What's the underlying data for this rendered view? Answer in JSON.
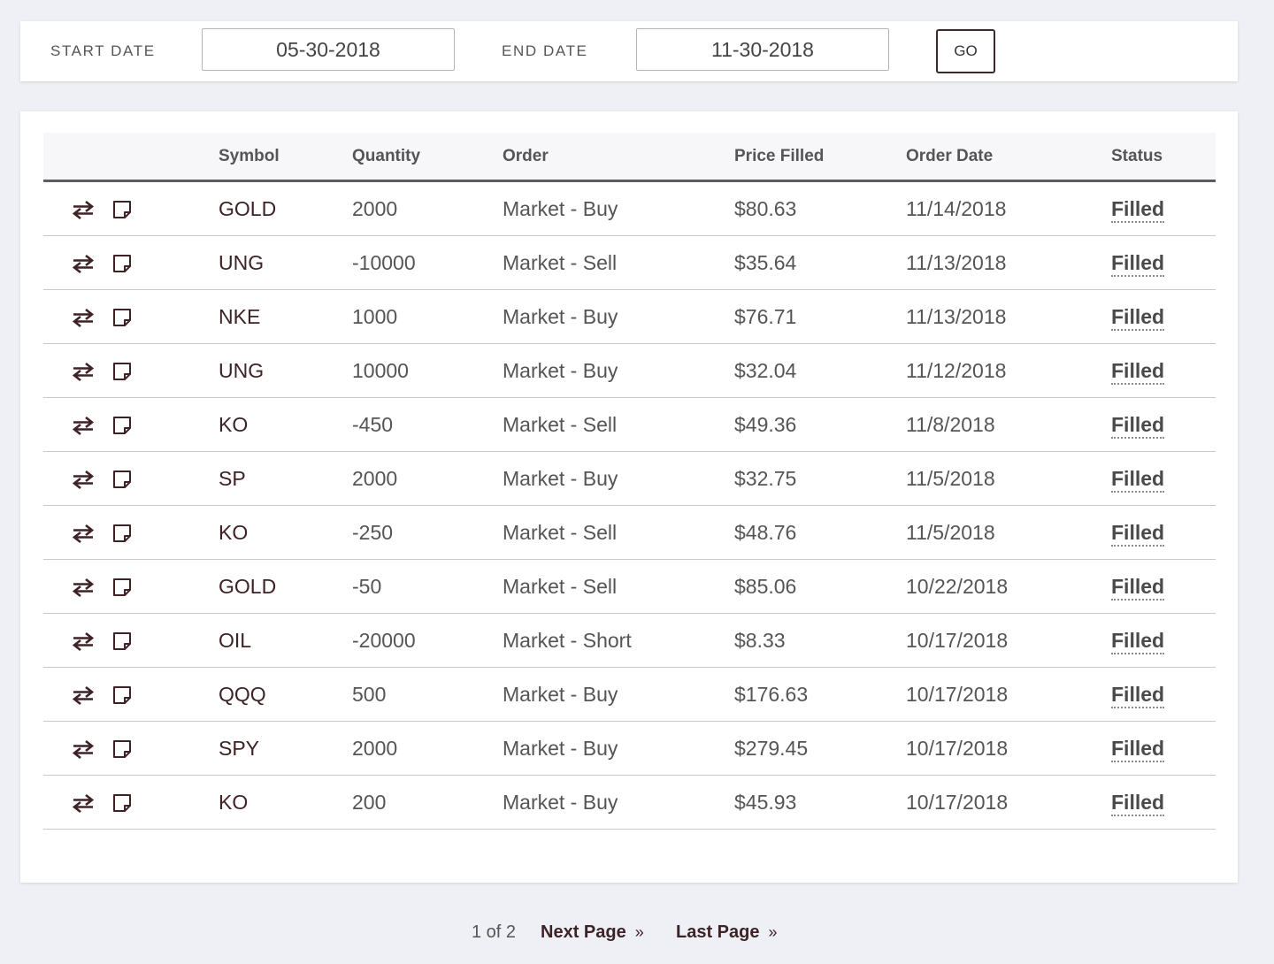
{
  "filter": {
    "start_label": "START DATE",
    "start_value": "05-30-2018",
    "end_label": "END DATE",
    "end_value": "11-30-2018",
    "go_label": "GO"
  },
  "table": {
    "headers": {
      "symbol": "Symbol",
      "quantity": "Quantity",
      "order": "Order",
      "price_filled": "Price Filled",
      "order_date": "Order Date",
      "status": "Status"
    },
    "row_icons": [
      "swap-arrows-icon",
      "note-icon"
    ],
    "rows": [
      {
        "symbol": "GOLD",
        "quantity": "2000",
        "order": "Market - Buy",
        "price": "$80.63",
        "date": "11/14/2018",
        "status": "Filled"
      },
      {
        "symbol": "UNG",
        "quantity": "-10000",
        "order": "Market - Sell",
        "price": "$35.64",
        "date": "11/13/2018",
        "status": "Filled"
      },
      {
        "symbol": "NKE",
        "quantity": "1000",
        "order": "Market - Buy",
        "price": "$76.71",
        "date": "11/13/2018",
        "status": "Filled"
      },
      {
        "symbol": "UNG",
        "quantity": "10000",
        "order": "Market - Buy",
        "price": "$32.04",
        "date": "11/12/2018",
        "status": "Filled"
      },
      {
        "symbol": "KO",
        "quantity": "-450",
        "order": "Market - Sell",
        "price": "$49.36",
        "date": "11/8/2018",
        "status": "Filled"
      },
      {
        "symbol": "SP",
        "quantity": "2000",
        "order": "Market - Buy",
        "price": "$32.75",
        "date": "11/5/2018",
        "status": "Filled"
      },
      {
        "symbol": "KO",
        "quantity": "-250",
        "order": "Market - Sell",
        "price": "$48.76",
        "date": "11/5/2018",
        "status": "Filled"
      },
      {
        "symbol": "GOLD",
        "quantity": "-50",
        "order": "Market - Sell",
        "price": "$85.06",
        "date": "10/22/2018",
        "status": "Filled"
      },
      {
        "symbol": "OIL",
        "quantity": "-20000",
        "order": "Market - Short",
        "price": "$8.33",
        "date": "10/17/2018",
        "status": "Filled"
      },
      {
        "symbol": "QQQ",
        "quantity": "500",
        "order": "Market - Buy",
        "price": "$176.63",
        "date": "10/17/2018",
        "status": "Filled"
      },
      {
        "symbol": "SPY",
        "quantity": "2000",
        "order": "Market - Buy",
        "price": "$279.45",
        "date": "10/17/2018",
        "status": "Filled"
      },
      {
        "symbol": "KO",
        "quantity": "200",
        "order": "Market - Buy",
        "price": "$45.93",
        "date": "10/17/2018",
        "status": "Filled"
      }
    ]
  },
  "pagination": {
    "info": "1 of 2",
    "next_label": "Next Page",
    "last_label": "Last Page",
    "arrow": "»"
  },
  "colors": {
    "accent": "#3d2226",
    "background": "#eef0f5",
    "card": "#ffffff"
  }
}
